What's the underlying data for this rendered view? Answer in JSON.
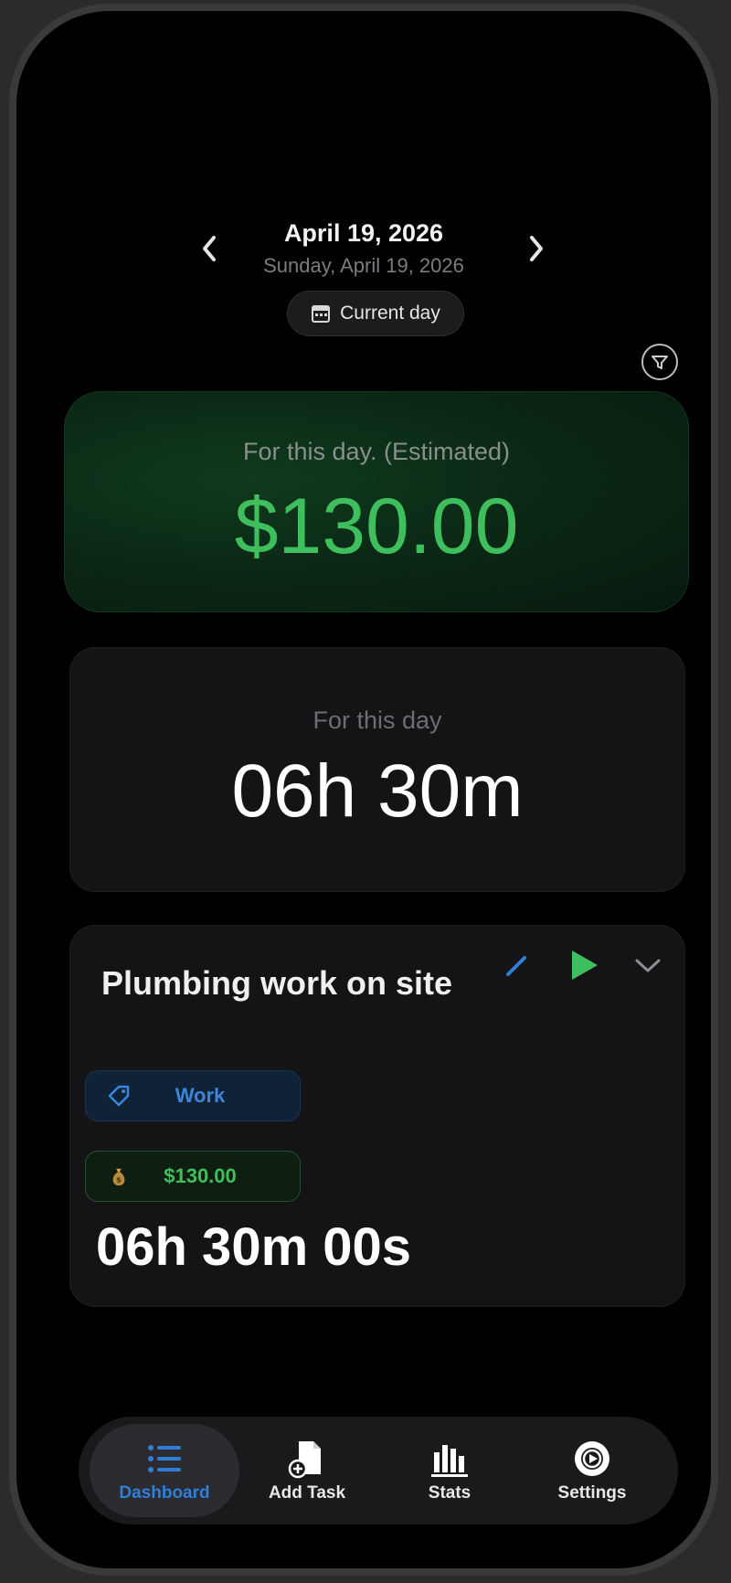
{
  "header": {
    "date_title": "April 19, 2026",
    "date_subtitle": "Sunday, April 19, 2026",
    "current_day_label": "Current day"
  },
  "earnings_card": {
    "label": "For this day. (Estimated)",
    "value": "$130.00"
  },
  "time_card": {
    "label": "For this day",
    "value": "06h 30m"
  },
  "task": {
    "title": "Plumbing work on site",
    "category": "Work",
    "amount": "$130.00",
    "elapsed": "06h 30m 00s"
  },
  "tabbar": {
    "items": [
      {
        "label": "Dashboard",
        "icon": "list-icon",
        "active": true
      },
      {
        "label": "Add Task",
        "icon": "add-document-icon",
        "active": false
      },
      {
        "label": "Stats",
        "icon": "bar-chart-icon",
        "active": false
      },
      {
        "label": "Settings",
        "icon": "settings-icon",
        "active": false
      }
    ]
  },
  "colors": {
    "accent_green": "#3fbe5d",
    "accent_blue": "#2f7fd6",
    "background": "#000000"
  }
}
